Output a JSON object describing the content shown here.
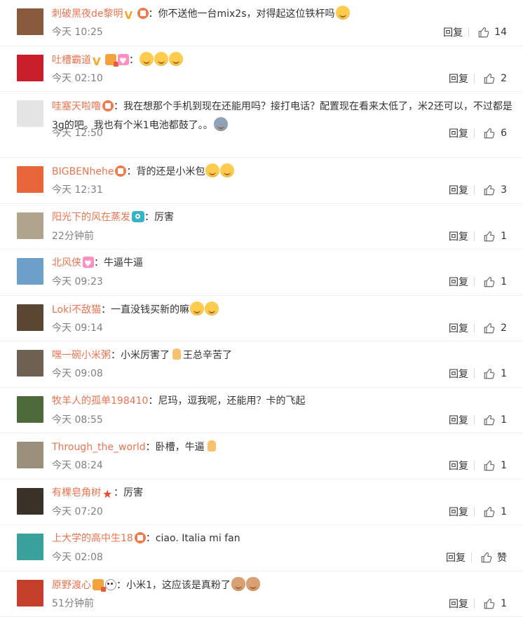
{
  "comments": [
    {
      "username": "刺破黑夜de黎明",
      "badges": [
        "v",
        "vip"
      ],
      "text": "你不送他一台mix2s，对得起这位铁杆吗",
      "emojis": [
        "laugh"
      ],
      "time": "今天 10:25",
      "reply": "回复",
      "likes": "14",
      "avatar_color": "#8a5a3c"
    },
    {
      "username": "吐槽霸道",
      "badges": [
        "v",
        "gold",
        "heart"
      ],
      "text": "",
      "emojis": [
        "grin",
        "grin",
        "grin"
      ],
      "time": "今天 02:10",
      "reply": "回复",
      "likes": "2",
      "avatar_color": "#c81e2c"
    },
    {
      "username": "哇塞天啦噜",
      "badges": [
        "vip"
      ],
      "text": "我在想那个手机到现在还能用吗？接打电话？配置现在看来太低了，米2还可以，不过都是3g的吧。我也有个米1电池都鼓了。。",
      "emojis": [
        "sad"
      ],
      "time": "今天 12:50",
      "reply": "回复",
      "likes": "6",
      "avatar_color": "#e5e5e5"
    },
    {
      "username": "BIGBENhehe",
      "badges": [
        "vip"
      ],
      "text": "背的还是小米包",
      "emojis": [
        "cry",
        "cry"
      ],
      "time": "今天 12:31",
      "reply": "回复",
      "likes": "3",
      "avatar_color": "#e9663b"
    },
    {
      "username": "阳光下的风在蒸发",
      "badges": [
        "camera"
      ],
      "text": "厉害",
      "emojis": [],
      "time": "22分钟前",
      "reply": "回复",
      "likes": "1",
      "avatar_color": "#b0a58c"
    },
    {
      "username": "北风侠",
      "badges": [
        "heart"
      ],
      "text": "牛逼牛逼",
      "emojis": [],
      "time": "今天 09:23",
      "reply": "回复",
      "likes": "1",
      "avatar_color": "#6c9fc9"
    },
    {
      "username": "Loki不敌猫",
      "badges": [],
      "text": "一直没钱买新的嘛",
      "emojis": [
        "grin",
        "grin"
      ],
      "time": "今天 09:14",
      "reply": "回复",
      "likes": "2",
      "avatar_color": "#5a4632"
    },
    {
      "username": "嘿一碗小米粥",
      "badges": [],
      "text": "小米厉害了",
      "emojis": [
        "thumb"
      ],
      "text2": "王总辛苦了",
      "time": "今天 09:08",
      "reply": "回复",
      "likes": "1",
      "avatar_color": "#6e6152"
    },
    {
      "username": "牧羊人的孤单198410",
      "badges": [],
      "text": "尼玛，逗我呢，还能用？卡的飞起",
      "emojis": [],
      "time": "今天 08:55",
      "reply": "回复",
      "likes": "1",
      "avatar_color": "#4d6b3a"
    },
    {
      "username": "Through_the_world",
      "badges": [],
      "text": "卧槽，牛逼",
      "emojis": [
        "thumb"
      ],
      "time": "今天 08:24",
      "reply": "回复",
      "likes": "1",
      "avatar_color": "#9a8f7b"
    },
    {
      "username": "有棵皂角树",
      "badges": [
        "star"
      ],
      "text": "厉害",
      "emojis": [],
      "time": "今天 07:20",
      "reply": "回复",
      "likes": "1",
      "avatar_color": "#3a3128"
    },
    {
      "username": "上大学的高中生18",
      "badges": [
        "vip"
      ],
      "text": "ciao. Italia mi fan",
      "emojis": [],
      "time": "今天 02:08",
      "reply": "回复",
      "likes": "赞",
      "avatar_color": "#3aa19c"
    },
    {
      "username": "原野渡心",
      "badges": [
        "gold",
        "panda"
      ],
      "text": "小米1，这应该是真粉了",
      "emojis": [
        "cat",
        "cat"
      ],
      "time": "51分钟前",
      "reply": "回复",
      "likes": "1",
      "avatar_color": "#c43f2a"
    }
  ],
  "colors": {
    "username": "#eb7350",
    "time": "#808080",
    "text": "#333333",
    "divider": "#eeeeee"
  }
}
